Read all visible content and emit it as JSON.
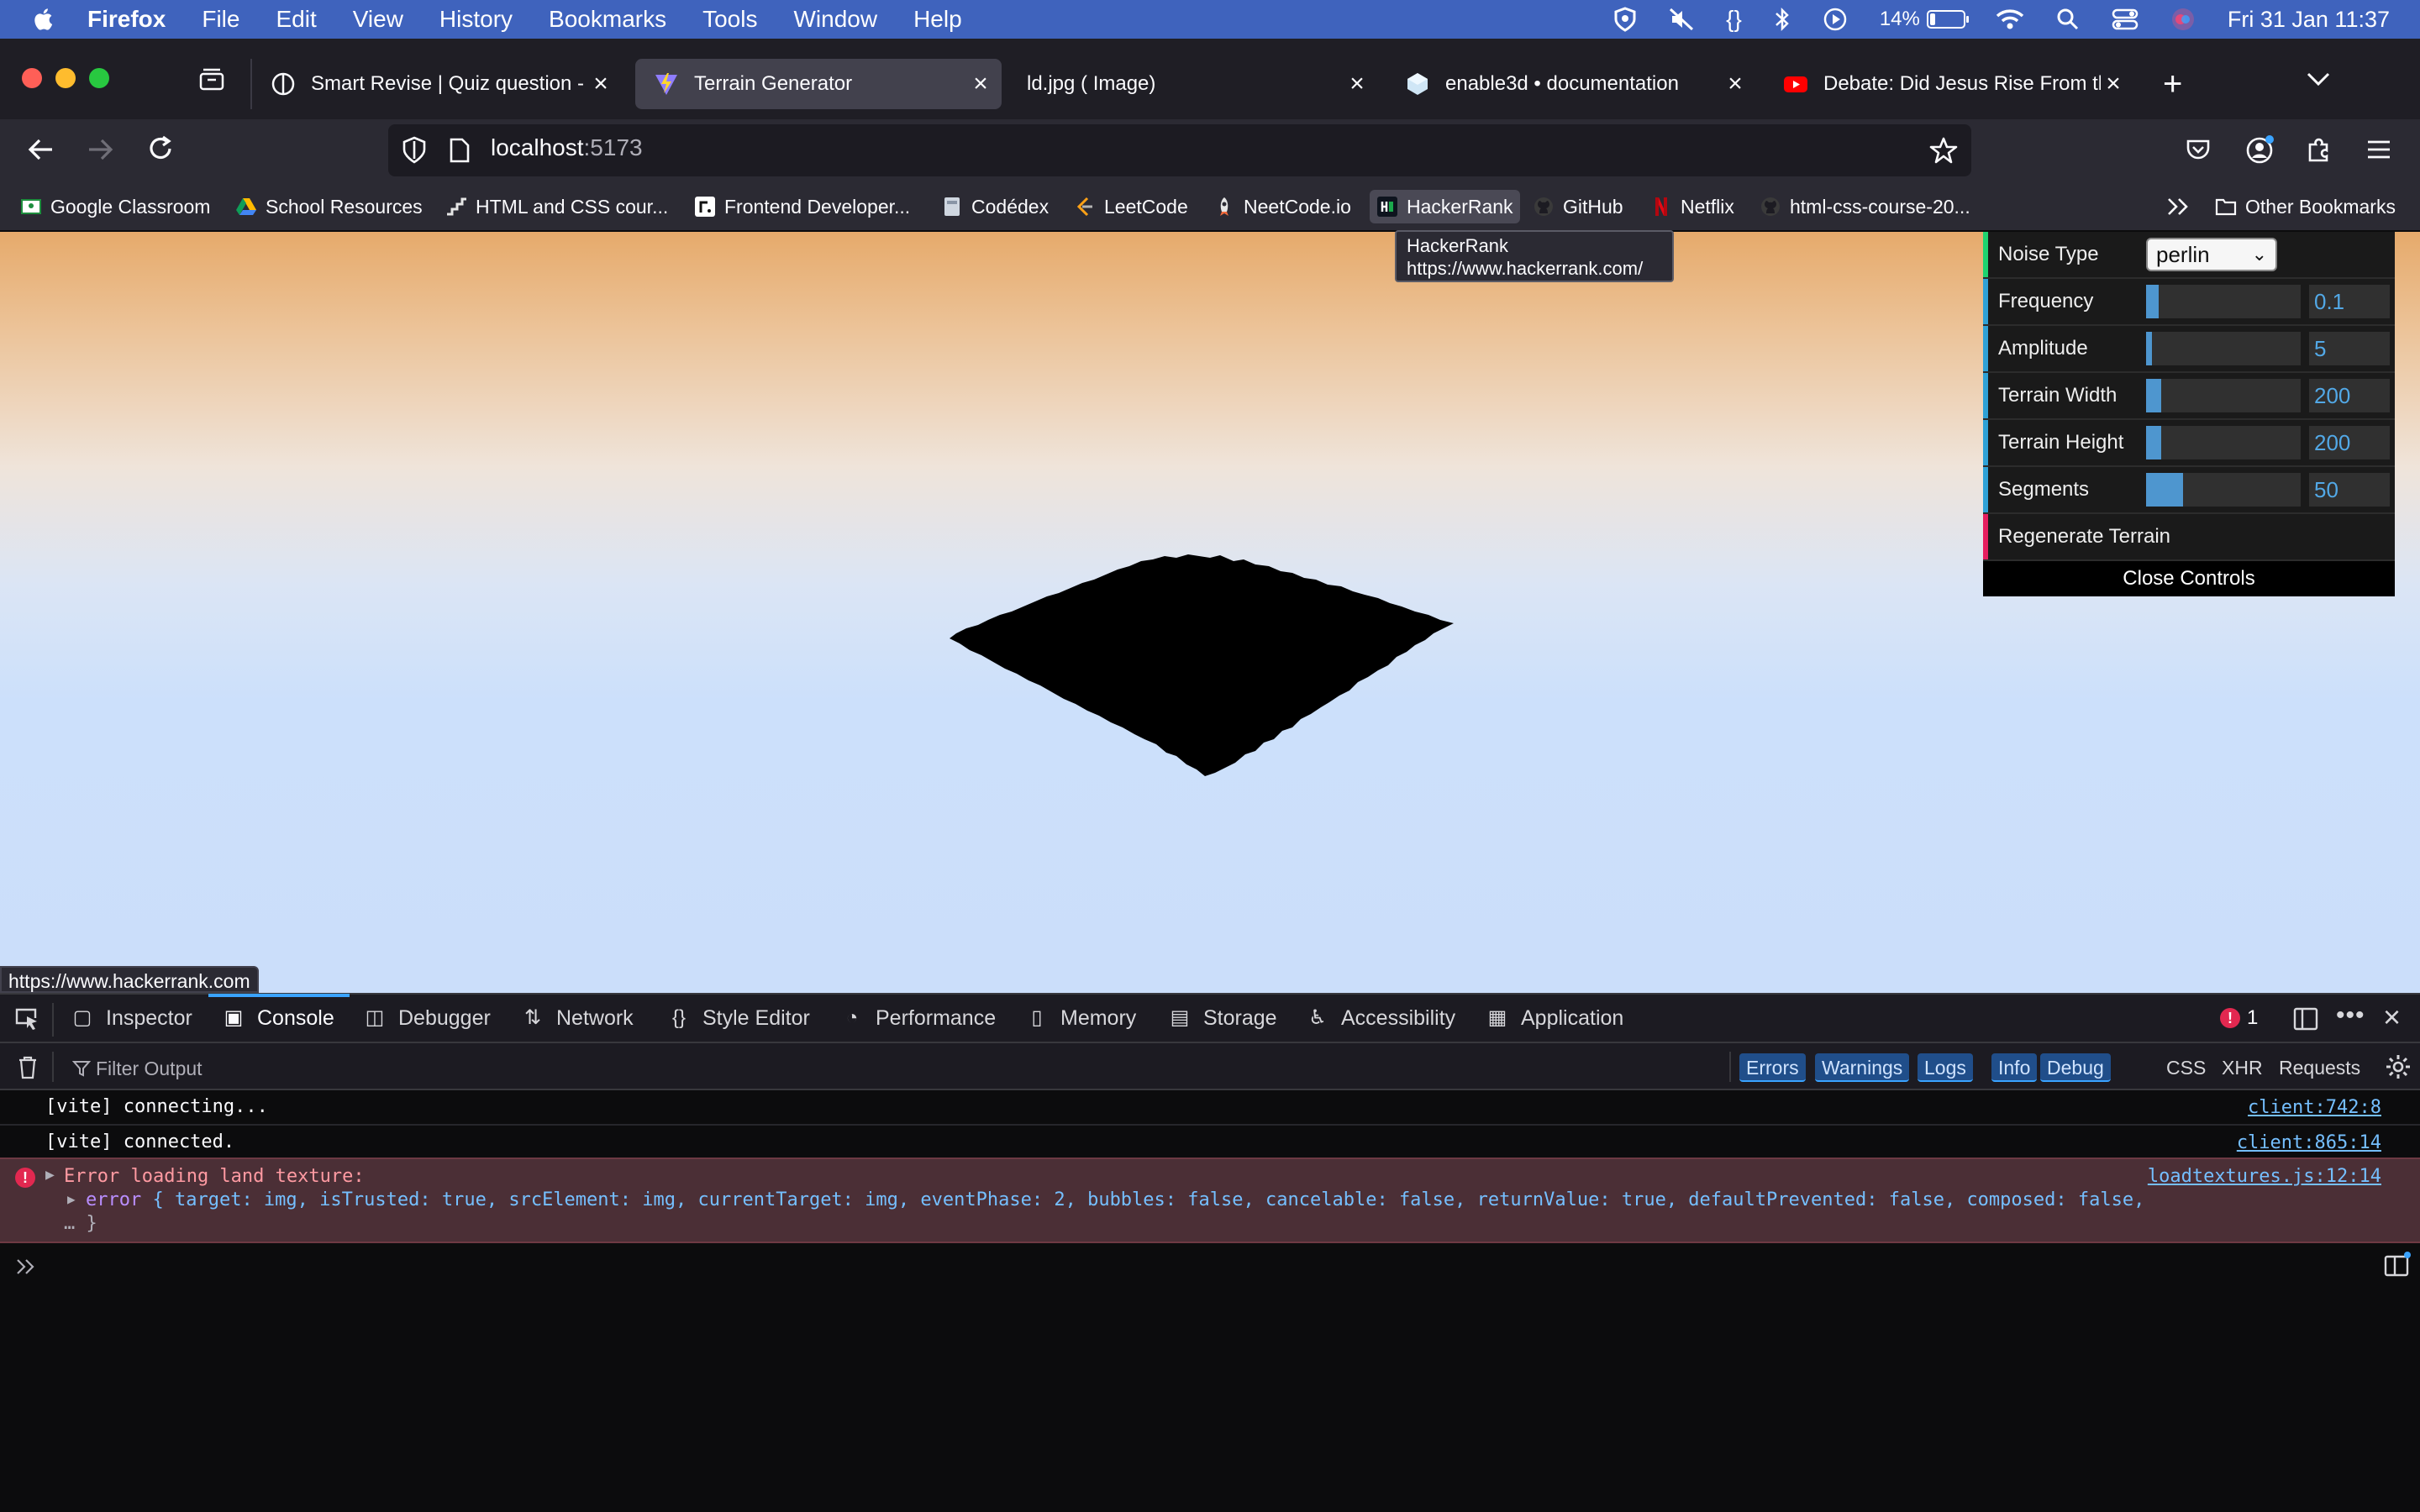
{
  "menubar": {
    "app": "Firefox",
    "items": [
      "File",
      "Edit",
      "View",
      "History",
      "Bookmarks",
      "Tools",
      "Window",
      "Help"
    ],
    "battery_percent": "14%",
    "clock": "Fri 31 Jan  11:37"
  },
  "tabs": [
    {
      "title": "Smart Revise | Quiz question - H",
      "active": false
    },
    {
      "title": "Terrain Generator",
      "active": true
    },
    {
      "title": "ld.jpg ( Image)",
      "active": false
    },
    {
      "title": "enable3d • documentation",
      "active": false
    },
    {
      "title": "Debate: Did Jesus Rise From the",
      "active": false
    }
  ],
  "urlbar": {
    "host": "localhost",
    "port": ":5173"
  },
  "bookmarks": [
    "Google Classroom",
    "School Resources",
    "HTML and CSS cour...",
    "Frontend Developer...",
    "Codédex",
    "LeetCode",
    "NeetCode.io",
    "HackerRank",
    "GitHub",
    "Netflix",
    "html-css-course-20..."
  ],
  "bookmarks_other": "Other Bookmarks",
  "tooltip": {
    "name": "HackerRank",
    "url": "https://www.hackerrank.com/"
  },
  "status_url": "https://www.hackerrank.com",
  "gui": {
    "noise_type_label": "Noise Type",
    "noise_type_value": "perlin",
    "controls": [
      {
        "label": "Frequency",
        "value": "0.1",
        "fill": 0.08,
        "color": "#2fa1d6"
      },
      {
        "label": "Amplitude",
        "value": "5",
        "fill": 0.04,
        "color": "#2fa1d6"
      },
      {
        "label": "Terrain Width",
        "value": "200",
        "fill": 0.1,
        "color": "#2fa1d6"
      },
      {
        "label": "Terrain Height",
        "value": "200",
        "fill": 0.1,
        "color": "#2fa1d6"
      },
      {
        "label": "Segments",
        "value": "50",
        "fill": 0.24,
        "color": "#2fa1d6"
      }
    ],
    "regenerate_label": "Regenerate Terrain",
    "close_label": "Close Controls"
  },
  "devtools": {
    "tabs": [
      "Inspector",
      "Console",
      "Debugger",
      "Network",
      "Style Editor",
      "Performance",
      "Memory",
      "Storage",
      "Accessibility",
      "Application"
    ],
    "active_tab": "Console",
    "error_count": "1",
    "filter_placeholder": "Filter Output",
    "filters": [
      "Errors",
      "Warnings",
      "Logs",
      "Info",
      "Debug",
      "CSS",
      "XHR",
      "Requests"
    ],
    "logs": [
      {
        "text": "[vite] connecting...",
        "source": "client:742:8"
      },
      {
        "text": "[vite] connected.",
        "source": "client:865:14"
      }
    ],
    "error": {
      "message": "Error loading land texture:",
      "source": "loadtextures.js:12:14",
      "detail_head": "error ",
      "detail_body": "{ target: img, isTrusted: true, srcElement: img, currentTarget: img, eventPhase: 2, bubbles: false, cancelable: false, returnValue: true, defaultPrevented: false, composed: false,",
      "detail_tail": "… }"
    }
  }
}
